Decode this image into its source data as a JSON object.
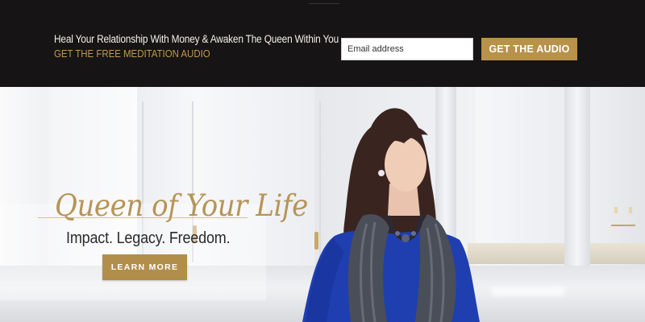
{
  "header": {
    "headline": "Heal Your Relationship With Money & Awaken The Queen Within You",
    "subheadline": "GET THE FREE MEDITATION AUDIO",
    "email_placeholder": "Email address",
    "cta_label": "GET THE AUDIO"
  },
  "hero": {
    "script_title": "Queen of Your Life",
    "tagline": "Impact. Legacy. Freedom.",
    "button_label": "LEARN MORE"
  },
  "colors": {
    "topbar_bg": "#161414",
    "gold_accent": "#b8914a",
    "gold_text": "#c29a4e",
    "dress_blue": "#1f3fb0"
  }
}
